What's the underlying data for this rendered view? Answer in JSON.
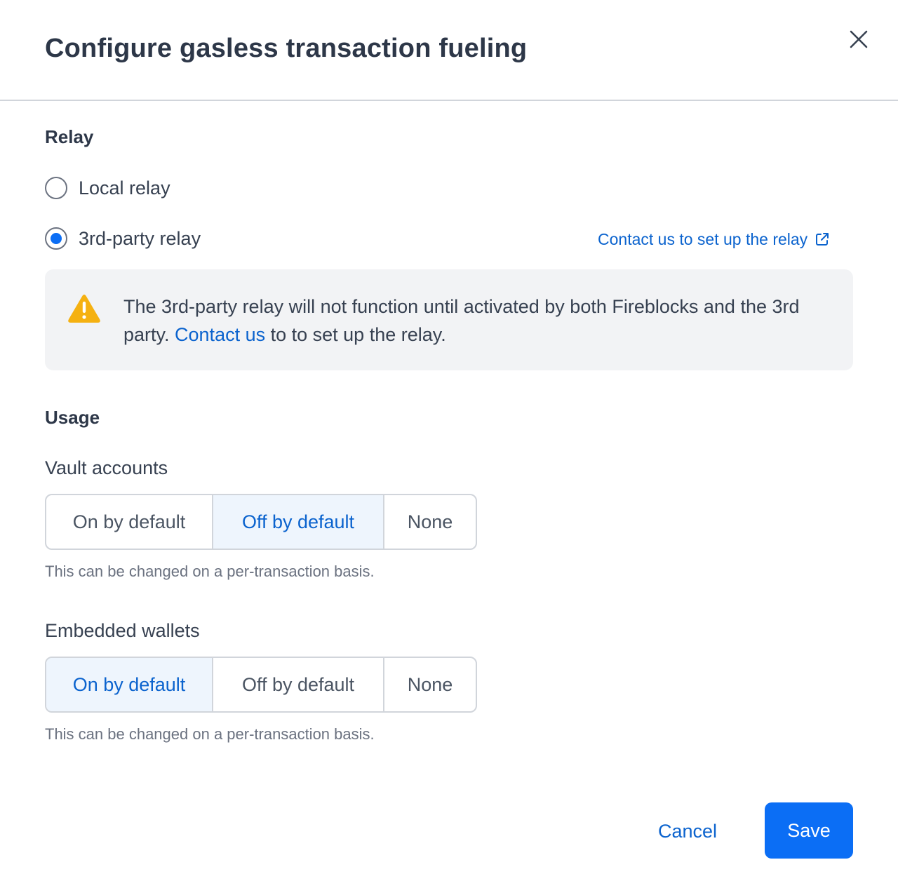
{
  "dialog": {
    "title": "Configure gasless transaction fueling"
  },
  "relay": {
    "section_title": "Relay",
    "options": [
      {
        "label": "Local relay",
        "selected": false
      },
      {
        "label": "3rd-party relay",
        "selected": true
      }
    ],
    "contact_link_label": "Contact us to set up the relay",
    "alert": {
      "text_before": "The 3rd-party relay will not function until activated by both Fireblocks and the 3rd party. ",
      "link_label": "Contact us",
      "text_after": " to to set up the relay."
    }
  },
  "usage": {
    "section_title": "Usage",
    "vault_accounts": {
      "label": "Vault accounts",
      "options": [
        "On by default",
        "Off by default",
        "None"
      ],
      "selected": "Off by default",
      "hint": "This can be changed on a per-transaction basis."
    },
    "embedded_wallets": {
      "label": "Embedded wallets",
      "options": [
        "On by default",
        "Off by default",
        "None"
      ],
      "selected": "On by default",
      "hint": "This can be changed on a per-transaction basis."
    }
  },
  "footer": {
    "cancel_label": "Cancel",
    "save_label": "Save"
  },
  "colors": {
    "accent": "#0b6ef5",
    "link": "#0b63ce",
    "warning": "#f5b111",
    "alert_bg": "#f2f3f5",
    "selected_bg": "#eef5fd"
  },
  "icons": {
    "close": "close-icon",
    "external_link": "external-link-icon",
    "warning": "warning-icon"
  }
}
